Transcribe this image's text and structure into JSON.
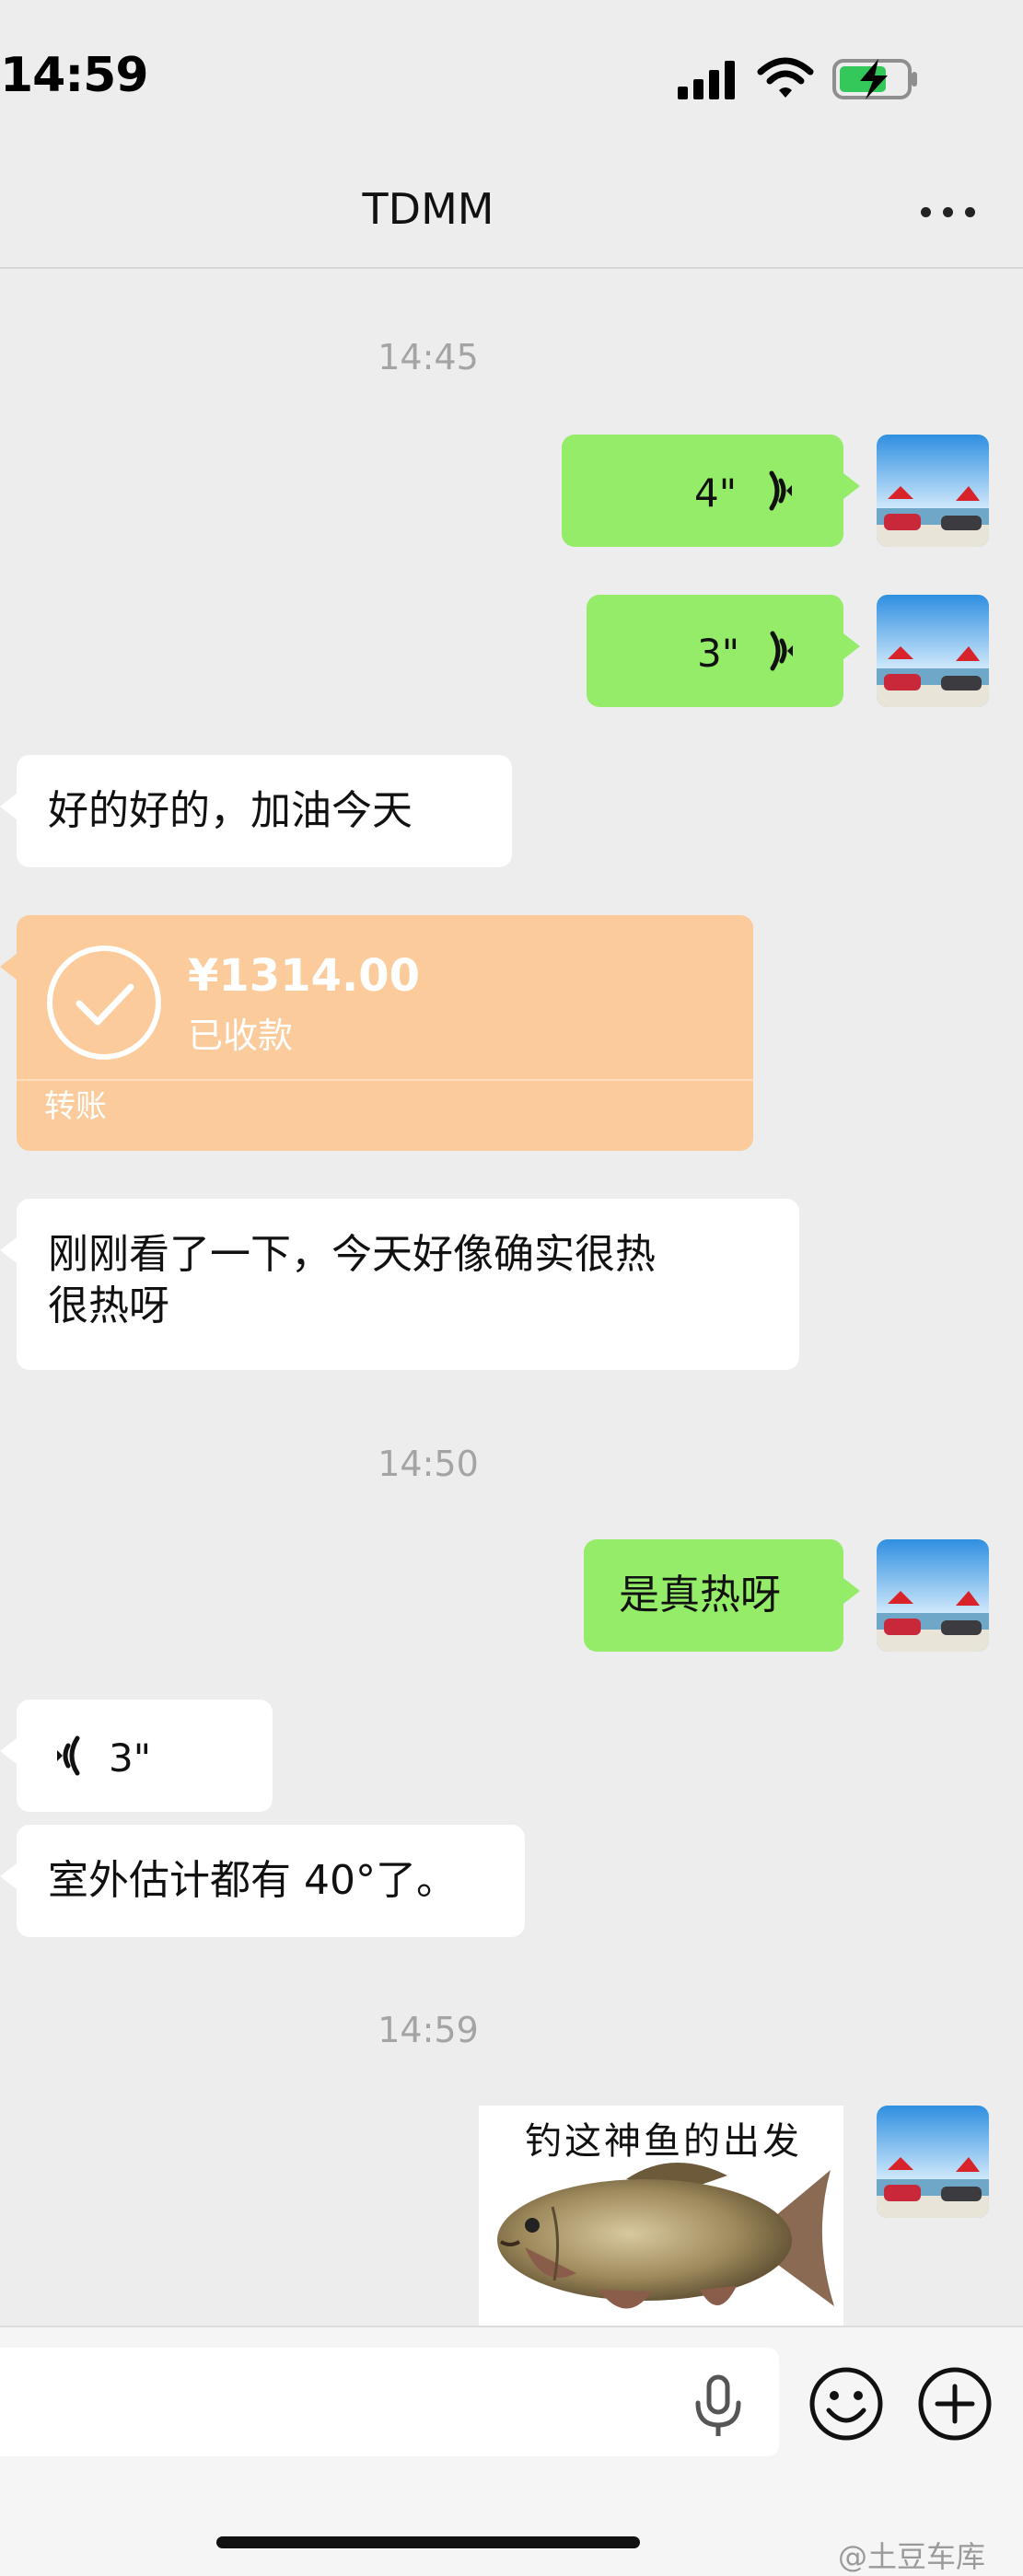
{
  "status_bar": {
    "time": "14:59",
    "battery": "charging"
  },
  "header": {
    "title": "TDMM",
    "more_icon": "more-dots-icon"
  },
  "messages": [
    {
      "type": "time",
      "text": "14:45"
    },
    {
      "type": "voice",
      "side": "me",
      "duration": "4\""
    },
    {
      "type": "voice",
      "side": "me",
      "duration": "3\""
    },
    {
      "type": "text",
      "side": "other",
      "text": "好的好的，加油今天"
    },
    {
      "type": "transfer",
      "side": "other",
      "amount": "¥1314.00",
      "status": "已收款",
      "label": "转账"
    },
    {
      "type": "text",
      "side": "other",
      "lines": [
        "刚刚看了一下，今天好像确实很热",
        "很热呀"
      ]
    },
    {
      "type": "time",
      "text": "14:50"
    },
    {
      "type": "text",
      "side": "me",
      "text": "是真热呀"
    },
    {
      "type": "voice",
      "side": "other",
      "duration": "3\""
    },
    {
      "type": "text",
      "side": "other",
      "text": "室外估计都有 40°了。"
    },
    {
      "type": "time",
      "text": "14:59"
    },
    {
      "type": "sticker",
      "side": "me",
      "caption": "钓这神鱼的出发",
      "icon": "goldfish-sticker"
    }
  ],
  "input_bar": {
    "placeholder": "",
    "icons": [
      "microphone-icon",
      "emoji-icon",
      "plus-icon"
    ]
  },
  "watermark": "@土豆车库",
  "colors": {
    "background": "#ededed",
    "my_bubble": "#95ec69",
    "other_bubble": "#ffffff",
    "transfer": "#fbcb9b"
  }
}
